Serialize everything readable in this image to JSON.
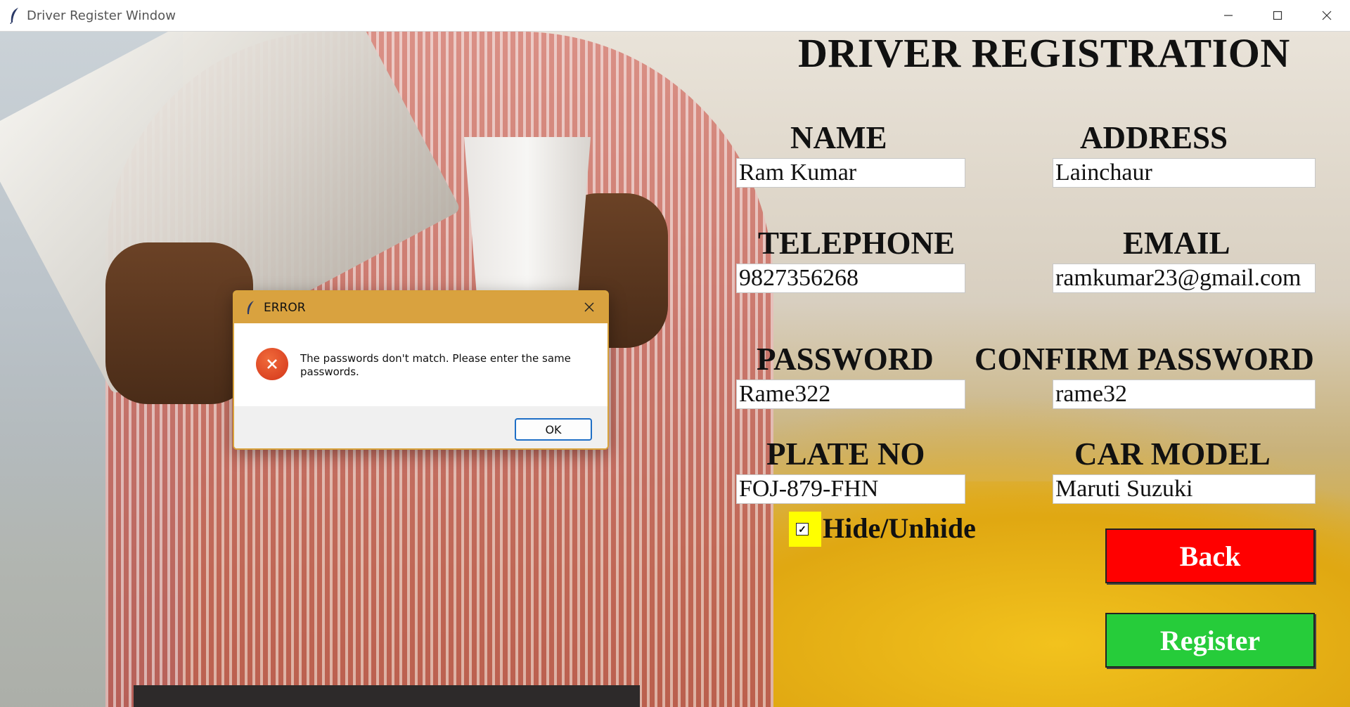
{
  "window": {
    "title": "Driver Register Window",
    "controls": {
      "minimize": "─",
      "maximize": "☐",
      "close": "✕"
    }
  },
  "form": {
    "title": "DRIVER REGISTRATION",
    "fields": {
      "name": {
        "label": "NAME",
        "value": "Ram Kumar"
      },
      "address": {
        "label": "ADDRESS",
        "value": "Lainchaur"
      },
      "telephone": {
        "label": "TELEPHONE",
        "value": "9827356268"
      },
      "email": {
        "label": "EMAIL",
        "value": "ramkumar23@gmail.com"
      },
      "password": {
        "label": "PASSWORD",
        "value": "Rame322"
      },
      "confirm_password": {
        "label": "CONFIRM PASSWORD",
        "value": "rame32"
      },
      "plate_no": {
        "label": "PLATE NO",
        "value": "FOJ-879-FHN"
      },
      "car_model": {
        "label": "CAR MODEL",
        "value": "Maruti Suzuki"
      }
    },
    "toggle": {
      "label": "Hide/Unhide",
      "checked": true,
      "checkmark": "✓",
      "highlight_color": "#ffff00"
    },
    "buttons": {
      "back": {
        "label": "Back",
        "color": "#ff0000"
      },
      "register": {
        "label": "Register",
        "color": "#26cc3a"
      }
    }
  },
  "dialog": {
    "title": "ERROR",
    "message": "The passwords don't match. Please enter the same passwords.",
    "ok_label": "OK",
    "close_glyph": "✕",
    "accent_color": "#d9a23f",
    "icon": "error-x-icon"
  }
}
